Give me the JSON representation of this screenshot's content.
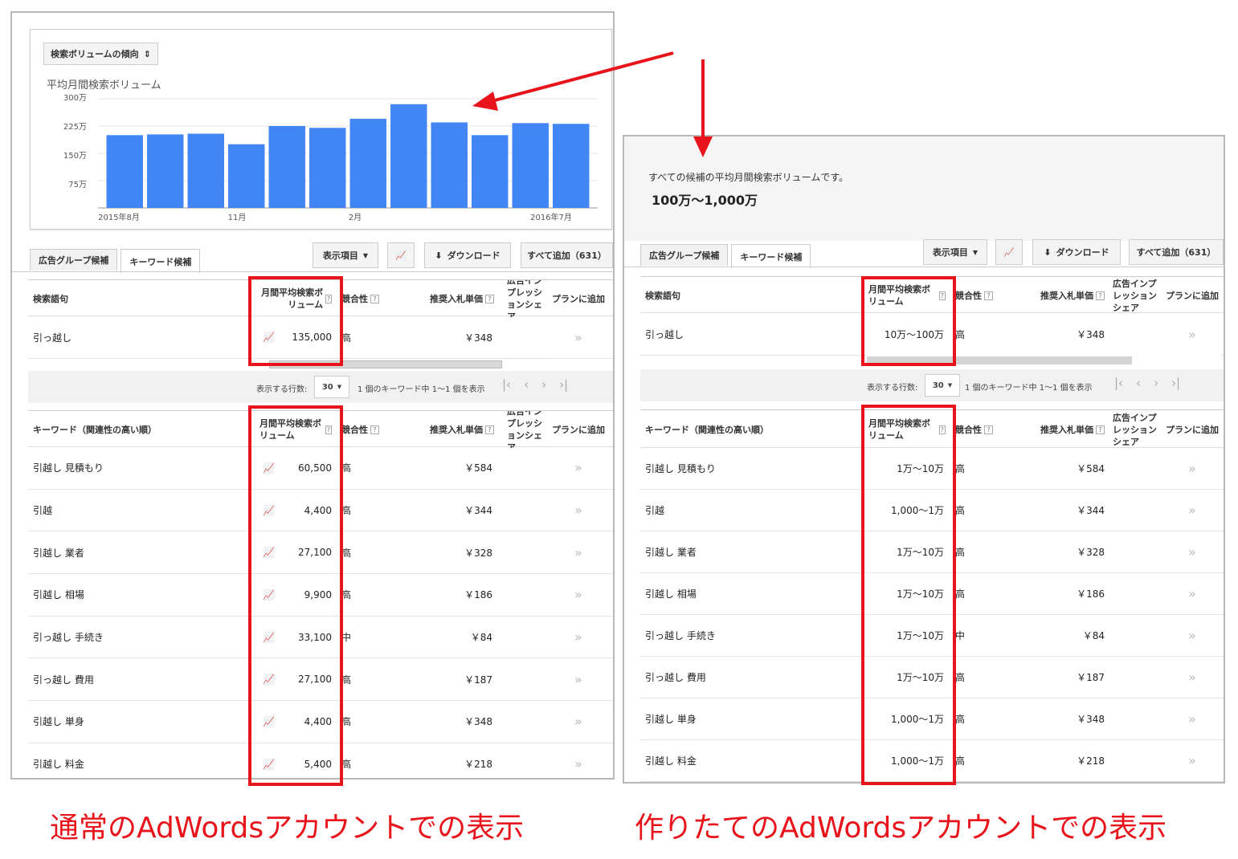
{
  "left": {
    "chart_select": "検索ボリュームの傾向",
    "chart_title": "平均月間検索ボリューム",
    "y_ticks": [
      "300万",
      "225万",
      "150万",
      "75万"
    ],
    "x_ticks": [
      "2015年8月",
      "11月",
      "2月",
      "2016年7月"
    ],
    "tabs": [
      "広告グループ候補",
      "キーワード候補"
    ],
    "btn_columns": "表示項目",
    "btn_download": "ダウンロード",
    "btn_add_all": "すべて追加（631）",
    "table1": {
      "headers": {
        "term": "検索語句",
        "volume": "月間平均検索ボリューム",
        "competition": "競合性",
        "bid": "推奨入札単価",
        "share": "広告インプレッションシェア",
        "plan": "プランに追加"
      },
      "rows": [
        {
          "keyword": "引っ越し",
          "volume": "135,000",
          "competition": "高",
          "bid": "￥348"
        }
      ]
    },
    "pager": {
      "rows_label": "表示する行数:",
      "per_page": "30",
      "info": "1 個のキーワード中 1～1 個を表示"
    },
    "table2": {
      "headers": {
        "term": "キーワード（関連性の高い順）",
        "volume": "月間平均検索ボリューム",
        "competition": "競合性",
        "bid": "推奨入札単価",
        "share": "広告インプレッションシェア",
        "plan": "プランに追加"
      },
      "rows": [
        {
          "keyword": "引越し 見積もり",
          "volume": "60,500",
          "competition": "高",
          "bid": "￥584"
        },
        {
          "keyword": "引越",
          "volume": "4,400",
          "competition": "高",
          "bid": "￥344"
        },
        {
          "keyword": "引越し 業者",
          "volume": "27,100",
          "competition": "高",
          "bid": "￥328"
        },
        {
          "keyword": "引越し 相場",
          "volume": "9,900",
          "competition": "高",
          "bid": "￥186"
        },
        {
          "keyword": "引っ越し 手続き",
          "volume": "33,100",
          "competition": "中",
          "bid": "￥84"
        },
        {
          "keyword": "引っ越し 費用",
          "volume": "27,100",
          "competition": "高",
          "bid": "￥187"
        },
        {
          "keyword": "引越し 単身",
          "volume": "4,400",
          "competition": "高",
          "bid": "￥348"
        },
        {
          "keyword": "引越し 料金",
          "volume": "5,400",
          "competition": "高",
          "bid": "￥218"
        }
      ]
    },
    "caption": "通常のAdWordsアカウントでの表示"
  },
  "right": {
    "summary_text": "すべての候補の平均月間検索ボリュームです。",
    "summary_value": "100万～1,000万",
    "tabs": [
      "広告グループ候補",
      "キーワード候補"
    ],
    "btn_columns": "表示項目",
    "btn_download": "ダウンロード",
    "btn_add_all": "すべて追加（631）",
    "table1": {
      "headers": {
        "term": "検索語句",
        "volume": "月間平均検索ボリューム",
        "competition": "競合性",
        "bid": "推奨入札単価",
        "share": "広告インプレッションシェア",
        "plan": "プランに追加"
      },
      "rows": [
        {
          "keyword": "引っ越し",
          "volume": "10万～100万",
          "competition": "高",
          "bid": "￥348"
        }
      ]
    },
    "pager": {
      "rows_label": "表示する行数:",
      "per_page": "30",
      "info": "1 個のキーワード中 1～1 個を表示"
    },
    "table2": {
      "headers": {
        "term": "キーワード（関連性の高い順）",
        "volume": "月間平均検索ボリューム",
        "competition": "競合性",
        "bid": "推奨入札単価",
        "share": "広告インプレッションシェア",
        "plan": "プランに追加"
      },
      "rows": [
        {
          "keyword": "引越し 見積もり",
          "volume": "1万～10万",
          "competition": "高",
          "bid": "￥584"
        },
        {
          "keyword": "引越",
          "volume": "1,000～1万",
          "competition": "高",
          "bid": "￥344"
        },
        {
          "keyword": "引越し 業者",
          "volume": "1万～10万",
          "competition": "高",
          "bid": "￥328"
        },
        {
          "keyword": "引越し 相場",
          "volume": "1万～10万",
          "competition": "高",
          "bid": "￥186"
        },
        {
          "keyword": "引っ越し 手続き",
          "volume": "1万～10万",
          "competition": "中",
          "bid": "￥84"
        },
        {
          "keyword": "引っ越し 費用",
          "volume": "1万～10万",
          "competition": "高",
          "bid": "￥187"
        },
        {
          "keyword": "引越し 単身",
          "volume": "1,000～1万",
          "competition": "高",
          "bid": "￥348"
        },
        {
          "keyword": "引越し 料金",
          "volume": "1,000～1万",
          "competition": "高",
          "bid": "￥218"
        }
      ]
    },
    "caption": "作りたてのAdWordsアカウントでの表示"
  },
  "chart_data": {
    "type": "bar",
    "categories": [
      "2015-08",
      "2015-09",
      "2015-10",
      "2015-11",
      "2015-12",
      "2016-01",
      "2016-02",
      "2016-03",
      "2016-04",
      "2016-05",
      "2016-06",
      "2016-07"
    ],
    "values": [
      2000000,
      2020000,
      2040000,
      1750000,
      2250000,
      2200000,
      2450000,
      2850000,
      2350000,
      2000000,
      2330000,
      2310000
    ],
    "title": "平均月間検索ボリューム",
    "ylim": [
      0,
      3000000
    ],
    "y_ticks": [
      750000,
      1500000,
      2250000,
      3000000
    ],
    "bar_color": "#4285f4"
  },
  "colors": {
    "highlight": "#e8141b",
    "bar": "#4285f4"
  }
}
